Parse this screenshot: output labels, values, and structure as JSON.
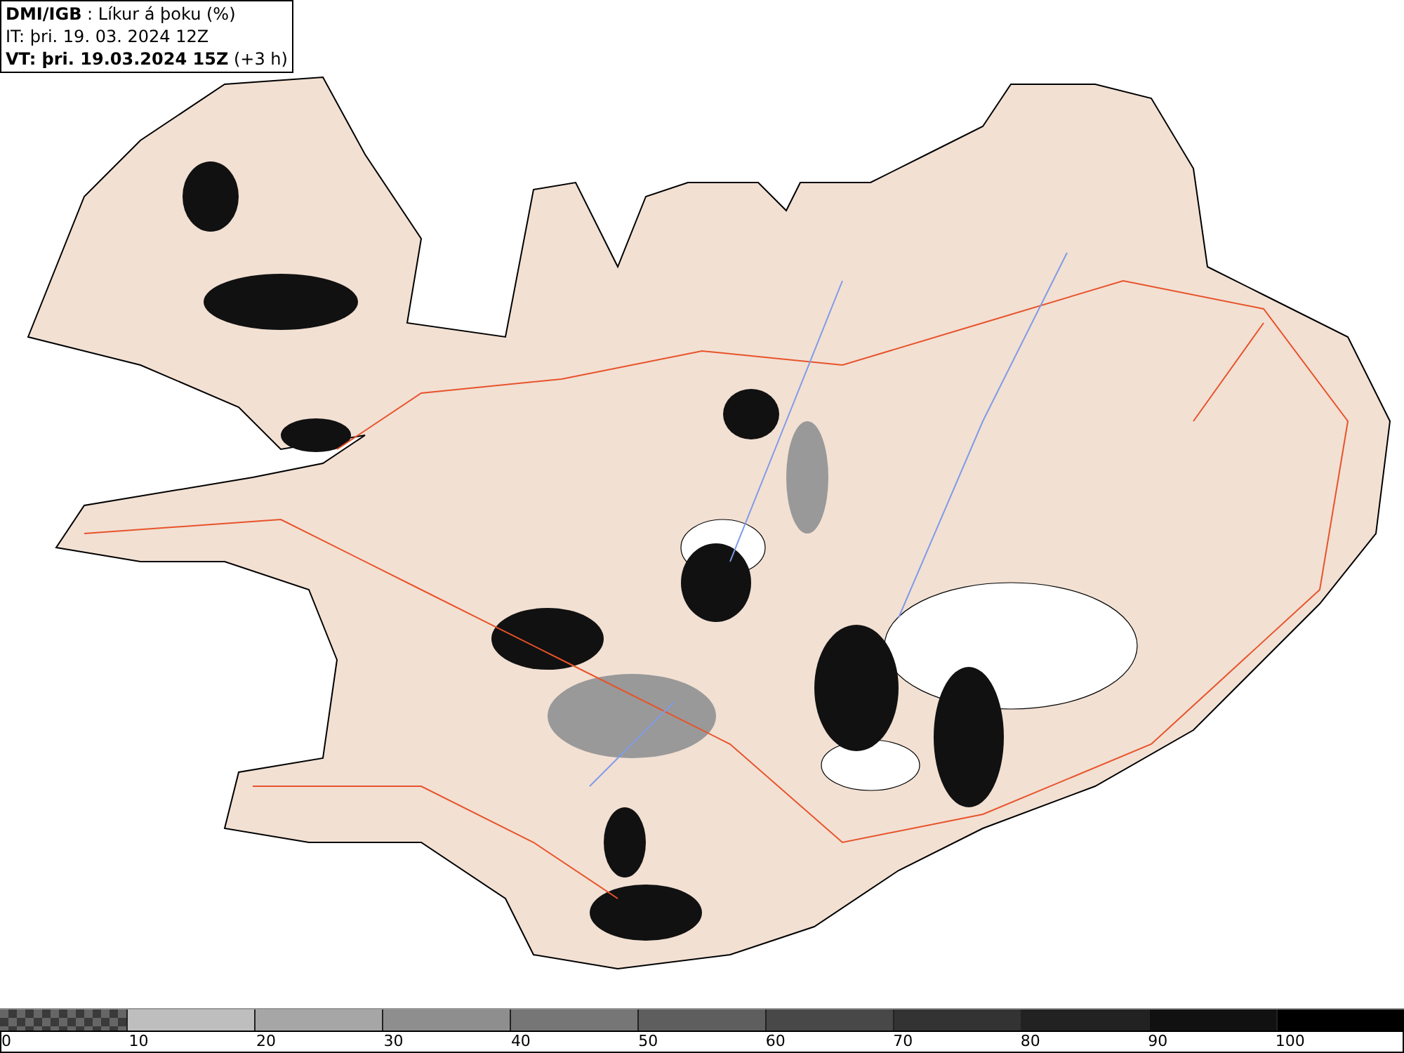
{
  "header": {
    "source": "DMI/IGB",
    "title": ": Líkur á þoku (%)",
    "issue_time": "IT: þri. 19. 03. 2024 12Z",
    "valid_time": "VT: þri. 19.03.2024 15Z",
    "valid_offset": "(+3 h)"
  },
  "legend": {
    "segments": [
      {
        "kind": "checker",
        "color": "#666666"
      },
      {
        "kind": "solid",
        "color": "#bebebe"
      },
      {
        "kind": "solid",
        "color": "#a6a6a6"
      },
      {
        "kind": "solid",
        "color": "#8e8e8e"
      },
      {
        "kind": "solid",
        "color": "#767676"
      },
      {
        "kind": "solid",
        "color": "#5e5e5e"
      },
      {
        "kind": "solid",
        "color": "#484848"
      },
      {
        "kind": "solid",
        "color": "#333333"
      },
      {
        "kind": "solid",
        "color": "#222222"
      },
      {
        "kind": "solid",
        "color": "#111111"
      },
      {
        "kind": "solid",
        "color": "#000000"
      }
    ],
    "ticks": [
      "0",
      "10",
      "20",
      "30",
      "40",
      "50",
      "60",
      "70",
      "80",
      "90",
      "100"
    ]
  }
}
